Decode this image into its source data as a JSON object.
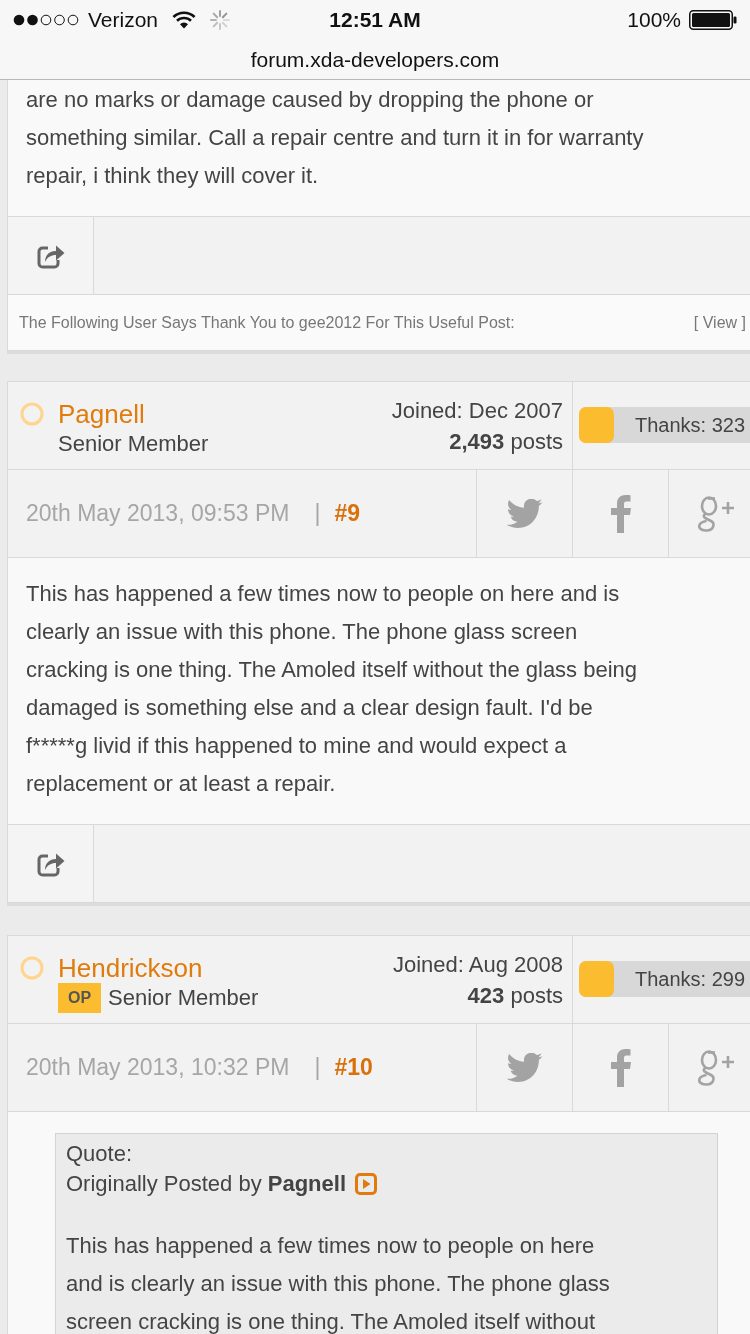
{
  "status_bar": {
    "carrier": "Verizon",
    "time": "12:51 AM",
    "battery": "100%"
  },
  "address_bar": {
    "url": "forum.xda-developers.com"
  },
  "posts": [
    {
      "kind": "partial",
      "body": "are no marks or damage caused by dropping the phone or\nsomething similar. Call a repair centre and turn it in for warranty\nrepair, i think they will cover it.",
      "thanks_note": "The Following User Says Thank You to gee2012 For This Useful Post:",
      "thanks_link": "[ View ]"
    },
    {
      "kind": "post",
      "author": {
        "name": "Pagnell",
        "online": false,
        "rank": "Senior Member",
        "joined": "Joined: Dec 2007",
        "posts": "**2,493** posts",
        "thanks": "Thanks: 323"
      },
      "date": "20th May 2013, 09:53 PM",
      "separator": "|",
      "number": "#9",
      "body": "This has happened a few times now to people on here and is\nclearly an issue with this phone. The phone glass screen\ncracking is one thing. The Amoled itself without the glass being\ndamaged is something else and a clear design fault. I'd be\nf*****g livid if this happened to mine and would expect a\nreplacement or at least a repair."
    },
    {
      "kind": "post",
      "author": {
        "name": "Hendrickson",
        "online": false,
        "op_label": "OP",
        "rank": "Senior Member",
        "joined": "Joined: Aug 2008",
        "posts": "**423** posts",
        "thanks": "Thanks: 299"
      },
      "date": "20th May 2013, 10:32 PM",
      "separator": "|",
      "number": "#10",
      "quote": {
        "label": "Quote:",
        "attribution": "Originally Posted by **Pagnell**",
        "text": "This has happened a few times now to people on here\nand is clearly an issue with this phone. The phone glass\nscreen cracking is one thing. The Amoled itself without"
      }
    }
  ]
}
